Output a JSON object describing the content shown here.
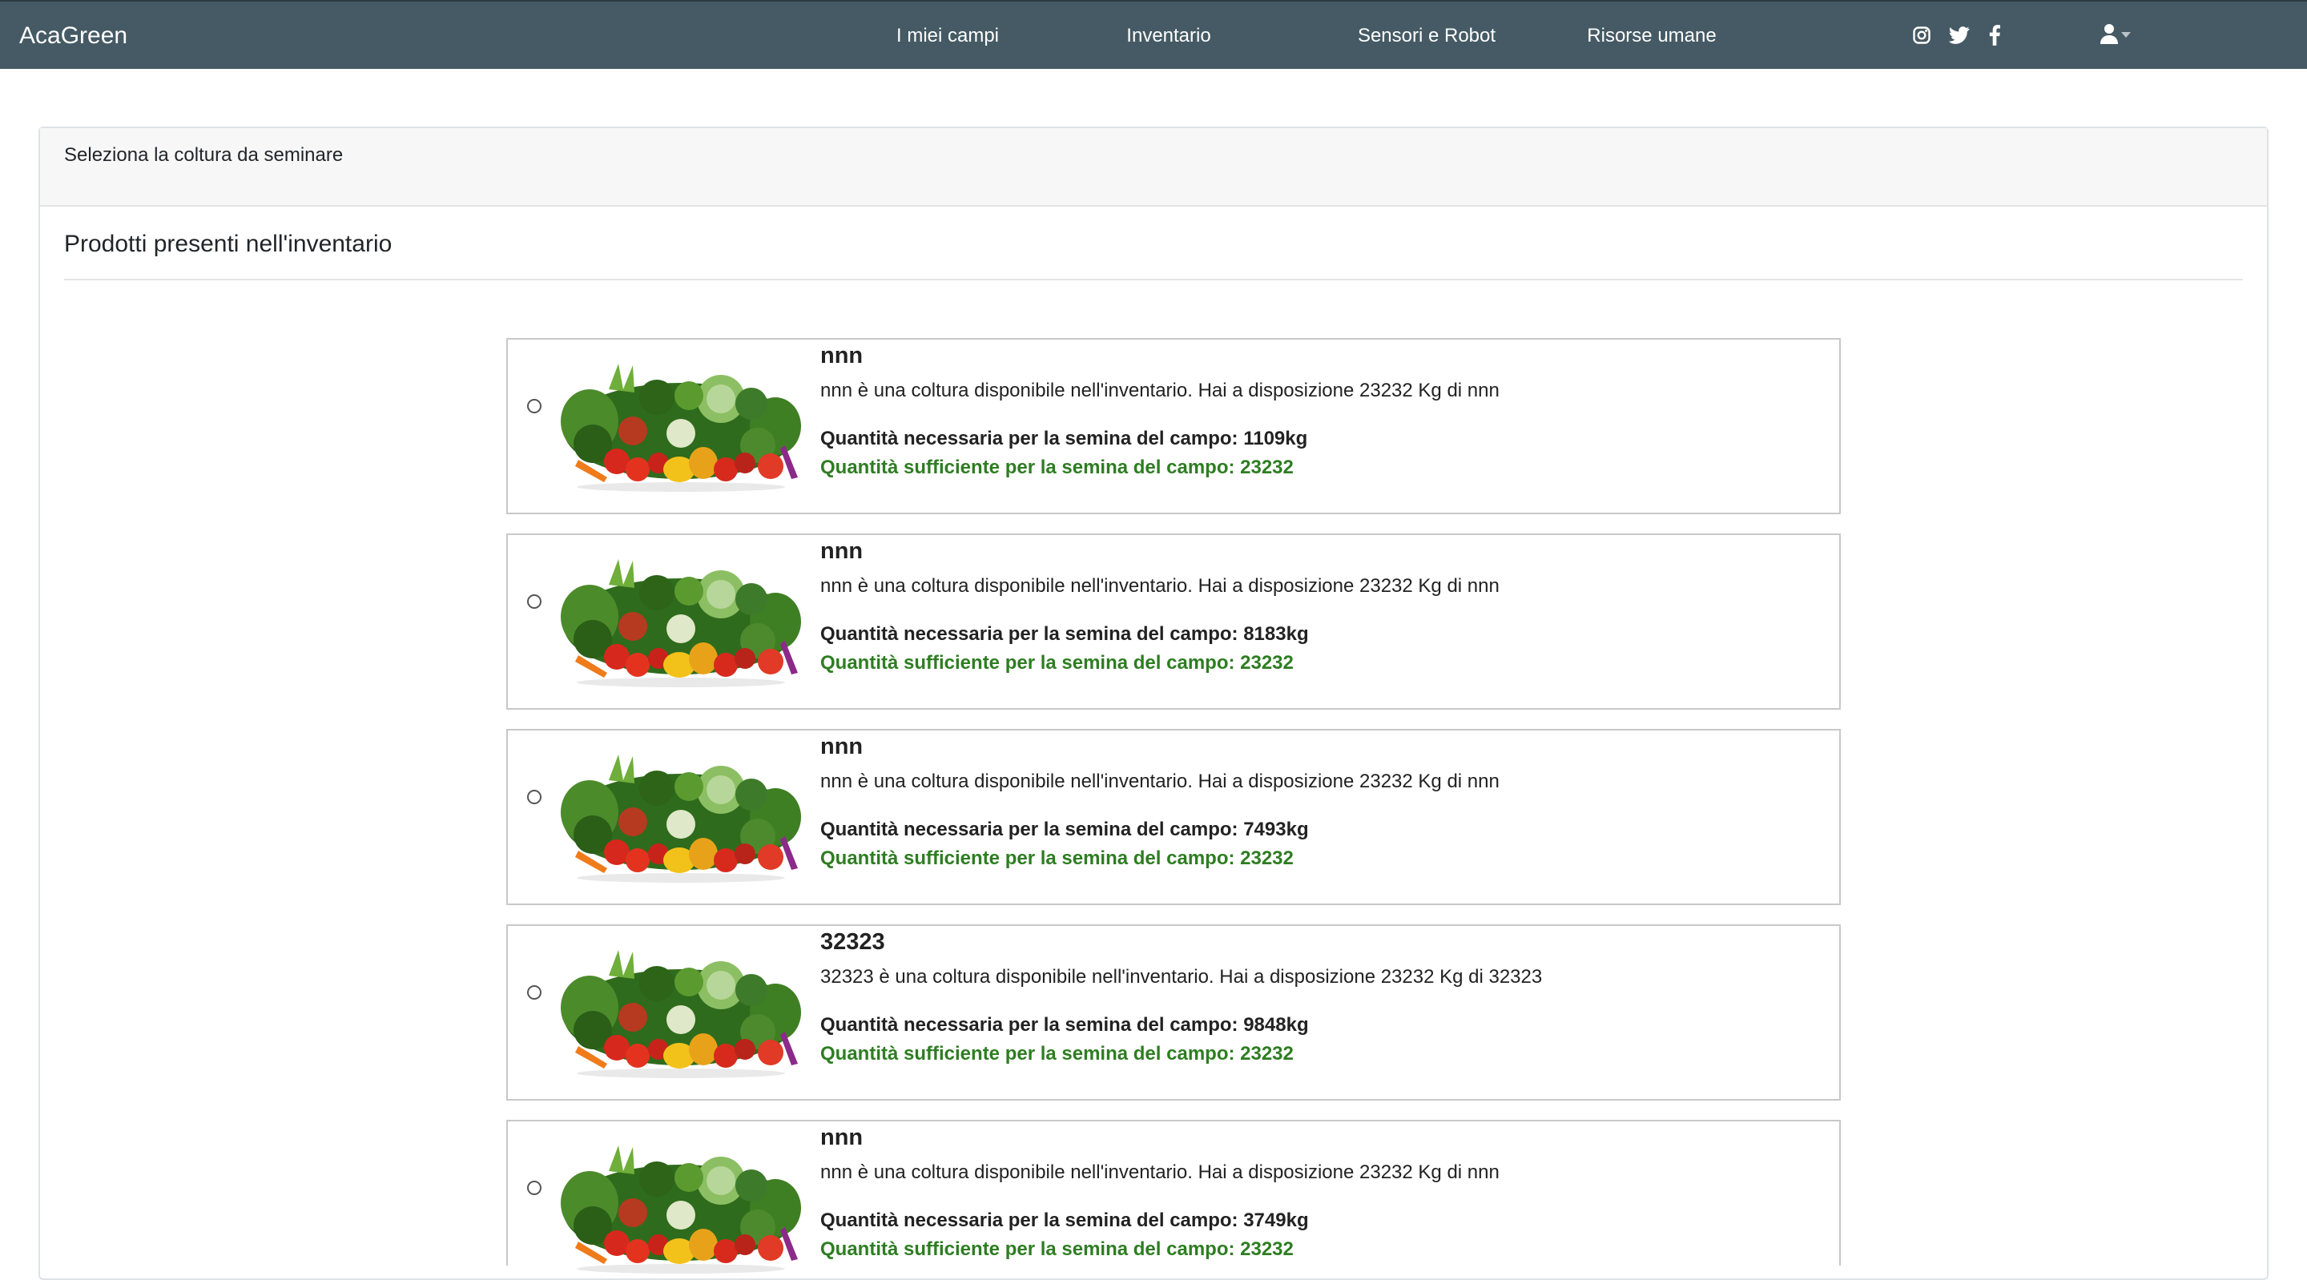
{
  "navbar": {
    "brand": "AcaGreen",
    "links": [
      "I miei campi",
      "Inventario",
      "Sensori e Robot",
      "Risorse umane"
    ],
    "social_icons": [
      "instagram-icon",
      "twitter-icon",
      "facebook-icon"
    ],
    "user_icon": "user-icon",
    "colors": {
      "background": "#455a64",
      "text": "#ffffff"
    }
  },
  "card": {
    "header": "Seleziona la coltura da seminare",
    "section_title": "Prodotti presenti nell'inventario"
  },
  "products": [
    {
      "name": "nnn",
      "description": "nnn è una coltura disponibile nell'inventario. Hai a disposizione 23232 Kg di nnn",
      "needed": "Quantità necessaria per la semina del campo: 1109kg",
      "sufficient": "Quantità sufficiente per la semina del campo: 23232"
    },
    {
      "name": "nnn",
      "description": "nnn è una coltura disponibile nell'inventario. Hai a disposizione 23232 Kg di nnn",
      "needed": "Quantità necessaria per la semina del campo: 8183kg",
      "sufficient": "Quantità sufficiente per la semina del campo: 23232"
    },
    {
      "name": "nnn",
      "description": "nnn è una coltura disponibile nell'inventario. Hai a disposizione 23232 Kg di nnn",
      "needed": "Quantità necessaria per la semina del campo: 7493kg",
      "sufficient": "Quantità sufficiente per la semina del campo: 23232"
    },
    {
      "name": "32323",
      "description": "32323 è una coltura disponibile nell'inventario. Hai a disposizione 23232 Kg di 32323",
      "needed": "Quantità necessaria per la semina del campo: 9848kg",
      "sufficient": "Quantità sufficiente per la semina del campo: 23232"
    },
    {
      "name": "nnn",
      "description": "nnn è una coltura disponibile nell'inventario. Hai a disposizione 23232 Kg di nnn",
      "needed": "Quantità necessaria per la semina del campo: 3749kg",
      "sufficient": "Quantità sufficiente per la semina del campo: 23232"
    }
  ],
  "colors": {
    "sufficient_text": "#2e7d22",
    "item_border": "#c8c8c8"
  }
}
